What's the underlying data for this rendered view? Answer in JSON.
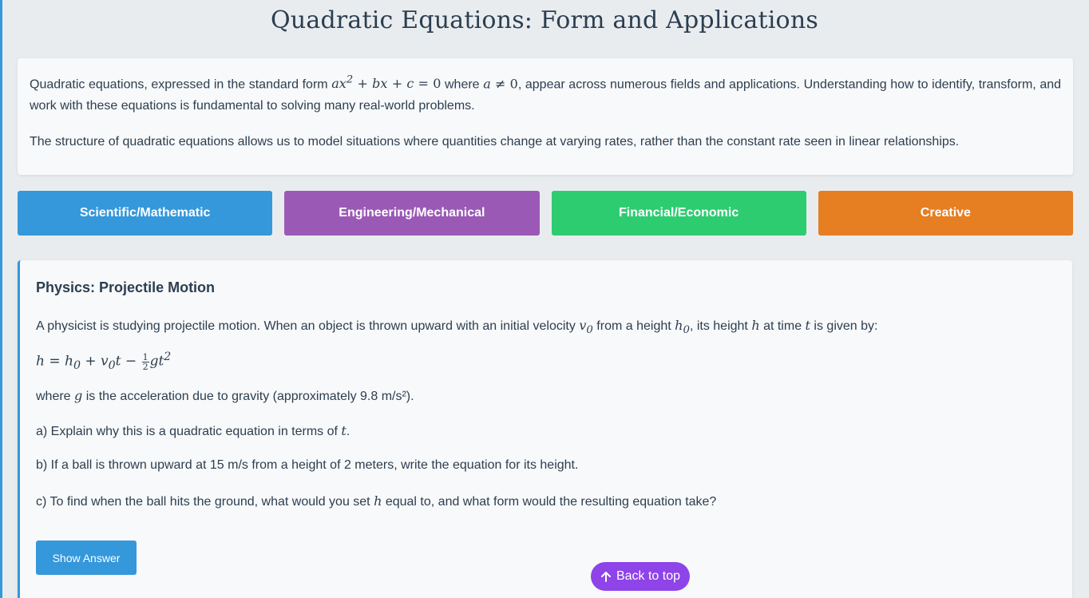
{
  "page": {
    "title": "Quadratic Equations: Form and Applications"
  },
  "intro": {
    "p1_a": "Quadratic equations, expressed in the standard form ",
    "p1_math1": "ax² + bx + c = 0",
    "p1_b": " where ",
    "p1_math2": "a ≠ 0",
    "p1_c": ", appear across numerous fields and applications. Understanding how to identify, transform, and work with these equations is fundamental to solving many real-world problems.",
    "p2": "The structure of quadratic equations allows us to model situations where quantities change at varying rates, rather than the constant rate seen in linear relationships."
  },
  "categories": [
    {
      "label": "Scientific/Mathematic",
      "color": "#3498db"
    },
    {
      "label": "Engineering/Mechanical",
      "color": "#9b59b6"
    },
    {
      "label": "Financial/Economic",
      "color": "#2ecc71"
    },
    {
      "label": "Creative",
      "color": "#e67e22"
    }
  ],
  "problem": {
    "title": "Physics: Projectile Motion",
    "line1_a": "A physicist is studying projectile motion. When an object is thrown upward with an initial velocity ",
    "line1_b": " from a height ",
    "line1_c": ", its height ",
    "line1_d": " at time ",
    "line1_e": " is given by:",
    "where_a": "where ",
    "where_b": " is the acceleration due to gravity (approximately 9.8 m/s²).",
    "qa_a": "a) Explain why this is a quadratic equation in terms of ",
    "qa_b": ".",
    "qb": "b) If a ball is thrown upward at 15 m/s from a height of 2 meters, write the equation for its height.",
    "qc_a": "c) To find when the ball hits the ground, what would you set ",
    "qc_b": " equal to, and what form would the resulting equation take?",
    "show_answer": "Show Answer"
  },
  "back_to_top": "Back to top"
}
